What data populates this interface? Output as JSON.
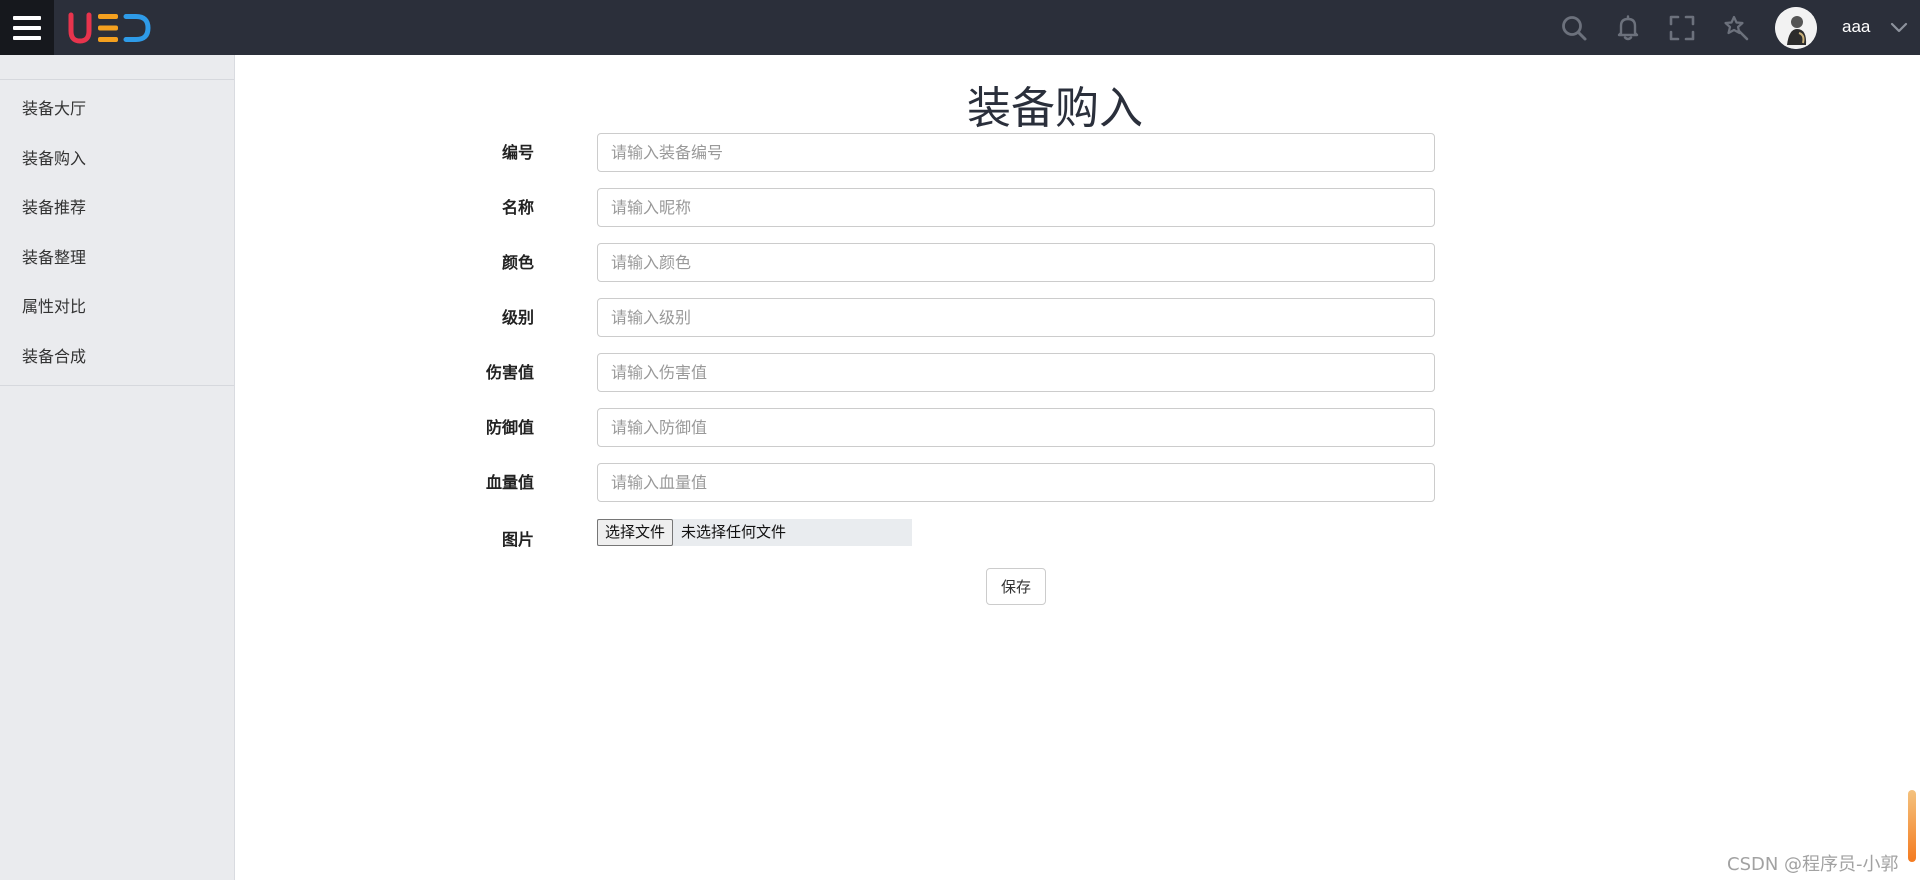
{
  "header": {
    "logo_text": "UED",
    "username": "aaa",
    "icons": [
      "menu-icon",
      "search-icon",
      "bell-icon",
      "fullscreen-icon",
      "magic-wand-icon",
      "avatar",
      "chevron-down-icon"
    ]
  },
  "sidebar": {
    "items": [
      {
        "label": "装备大厅"
      },
      {
        "label": "装备购入"
      },
      {
        "label": "装备推荐"
      },
      {
        "label": "装备整理"
      },
      {
        "label": "属性对比"
      },
      {
        "label": "装备合成"
      }
    ]
  },
  "main": {
    "title": "装备购入",
    "fields": [
      {
        "label": "编号",
        "placeholder": "请输入装备编号",
        "value": ""
      },
      {
        "label": "名称",
        "placeholder": "请输入昵称",
        "value": ""
      },
      {
        "label": "颜色",
        "placeholder": "请输入颜色",
        "value": ""
      },
      {
        "label": "级别",
        "placeholder": "请输入级别",
        "value": ""
      },
      {
        "label": "伤害值",
        "placeholder": "请输入伤害值",
        "value": ""
      },
      {
        "label": "防御值",
        "placeholder": "请输入防御值",
        "value": ""
      },
      {
        "label": "血量值",
        "placeholder": "请输入血量值",
        "value": ""
      }
    ],
    "image_field": {
      "label": "图片",
      "button_label": "选择文件",
      "status_text": "未选择任何文件"
    },
    "save_label": "保存"
  },
  "watermark": "CSDN @程序员-小郭",
  "colors": {
    "topbar": "#2b2f3a",
    "sidebar": "#eaebee",
    "logo_red": "#e8344d",
    "logo_orange": "#f4a01f",
    "logo_blue": "#2e9be8"
  }
}
